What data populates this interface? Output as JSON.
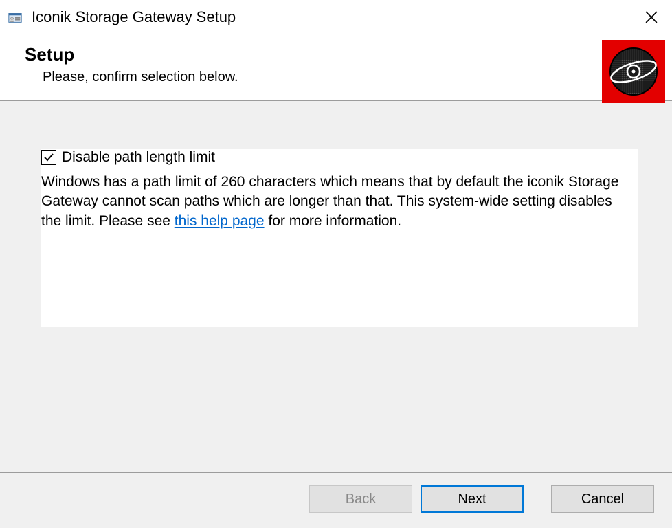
{
  "titlebar": {
    "title": "Iconik Storage Gateway Setup"
  },
  "header": {
    "heading": "Setup",
    "subtitle": "Please, confirm selection below."
  },
  "content": {
    "checkbox_label": "Disable path length limit",
    "checkbox_checked": true,
    "description_before": "Windows has a path limit of 260 characters which means that by default the iconik Storage Gateway cannot scan paths which are longer than that. This system-wide setting disables the limit. Please see ",
    "link_text": "this help page",
    "description_after": " for more information."
  },
  "footer": {
    "back": "Back",
    "next": "Next",
    "cancel": "Cancel"
  }
}
